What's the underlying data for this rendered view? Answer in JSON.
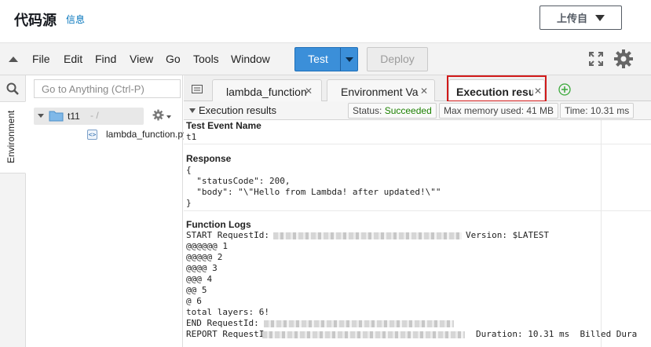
{
  "header": {
    "title": "代码源",
    "info_link": "信息",
    "upload_button": "上传自"
  },
  "menubar": {
    "items": [
      "File",
      "Edit",
      "Find",
      "View",
      "Go",
      "Tools",
      "Window"
    ],
    "test_button": "Test",
    "deploy_button": "Deploy"
  },
  "rail": {
    "tab_label": "Environment"
  },
  "tree": {
    "goto_placeholder": "Go to Anything (Ctrl-P)",
    "folder_name": "t11",
    "folder_path": "- /",
    "file_name": "lambda_function.py"
  },
  "tabs": [
    {
      "label": "lambda_function"
    },
    {
      "label": "Environment Var"
    },
    {
      "label": "Execution results"
    }
  ],
  "results_bar": {
    "title": "Execution results",
    "status_label": "Status:",
    "status_value": "Succeeded",
    "memory": "Max memory used: 41 MB",
    "time": "Time: 10.31 ms"
  },
  "results": {
    "event_heading": "Test Event Name",
    "event_name": "t1",
    "response_heading": "Response",
    "response_lines": [
      "{",
      "  \"statusCode\": 200,",
      "  \"body\": \"\\\"Hello from Lambda! after updated!\\\"\"",
      "}"
    ],
    "logs_heading": "Function Logs",
    "log_start_prefix": "START RequestId:",
    "log_start_suffix": "Version: $LATEST",
    "log_lines": [
      "@@@@@@ 1",
      "@@@@@ 2",
      "@@@@ 3",
      "@@@ 4",
      "@@ 5",
      "@ 6",
      "total layers: 6!"
    ],
    "log_end_prefix": "END RequestId:",
    "log_report_prefix": "REPORT RequestI",
    "log_report_suffix": "Duration: 10.31 ms  Billed Dura"
  },
  "colors": {
    "accent": "#3b8fd9",
    "success": "#1d8102",
    "link": "#0073bb",
    "focus_outline": "#d11a1a"
  },
  "icons": [
    "menu-collapse-icon",
    "caret-down-icon",
    "fullscreen-icon",
    "gear-icon",
    "search-icon",
    "folder-icon",
    "python-file-icon",
    "tabs-menu-icon",
    "close-icon",
    "add-tab-icon"
  ]
}
